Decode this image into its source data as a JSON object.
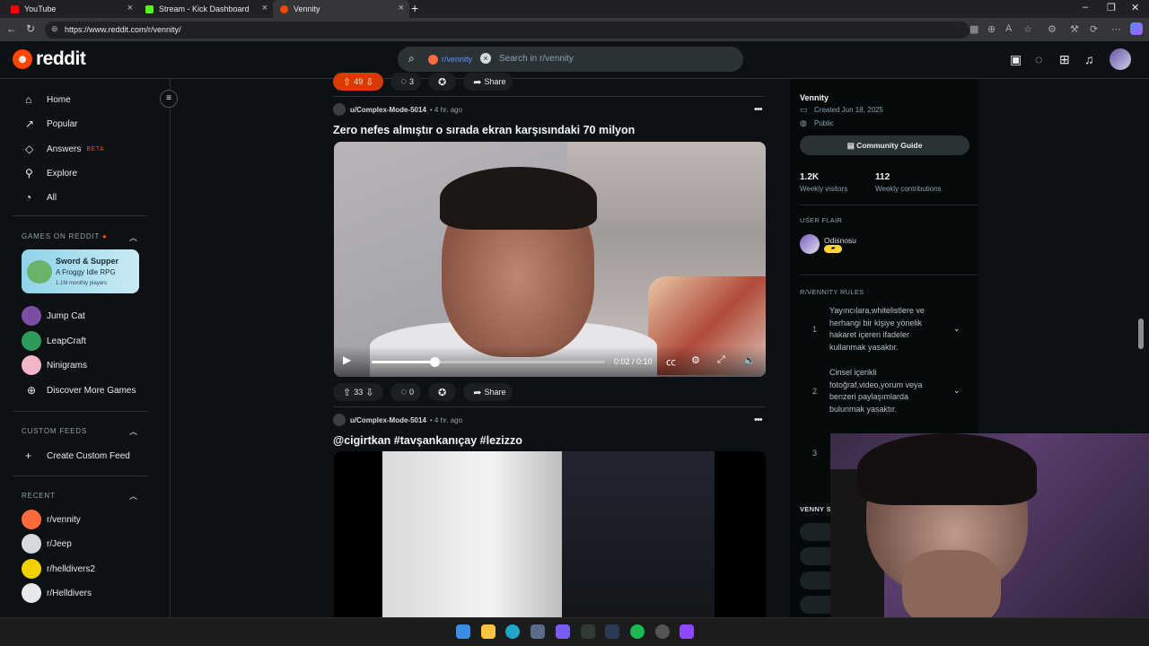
{
  "browser": {
    "tabs": [
      {
        "label": "YouTube",
        "color": "#ff0000"
      },
      {
        "label": "Stream - Kick Dashboard",
        "color": "#53fc18"
      },
      {
        "label": "Vennity",
        "color": "#ff4500"
      }
    ],
    "url": "https://www.reddit.com/r/vennity/"
  },
  "header": {
    "logo_text": "reddit",
    "search_chip": "r/vennity",
    "search_placeholder": "Search in r/vennity"
  },
  "sidebar": {
    "nav": [
      {
        "label": "Home",
        "icon": "home-icon"
      },
      {
        "label": "Popular",
        "icon": "popular-icon"
      },
      {
        "label": "Answers",
        "icon": "answers-icon",
        "badge": "BETA"
      },
      {
        "label": "Explore",
        "icon": "explore-icon"
      },
      {
        "label": "All",
        "icon": "all-icon"
      }
    ],
    "games_heading": "GAMES ON REDDIT",
    "featured_game": {
      "title": "Sword & Supper",
      "subtitle": "A Froggy Idle RPG",
      "players": "1.1M monthly players"
    },
    "games": [
      "Jump Cat",
      "LeapCraft",
      "Ninigrams",
      "Discover More Games"
    ],
    "custom_heading": "CUSTOM FEEDS",
    "create_feed": "Create Custom Feed",
    "recent_heading": "RECENT",
    "recent": [
      "r/vennity",
      "r/Jeep",
      "r/helldivers2",
      "r/Helldivers"
    ]
  },
  "feed": {
    "top_actions": {
      "votes": "49",
      "comments": "3",
      "share": "Share"
    },
    "post1": {
      "user": "u/Complex-Mode-5014",
      "time": "• 4 hr. ago",
      "title": "Zero nefes almıştır o sırada ekran karşısındaki 70 milyon",
      "video_time": "0:02 / 0:10",
      "progress": 0.27,
      "votes": "33",
      "comments": "0",
      "share": "Share"
    },
    "post2": {
      "user": "u/Complex-Mode-5014",
      "time": "• 4 hr. ago",
      "title": "@cigirtkan #tavşankanıçay #lezizzo"
    }
  },
  "right": {
    "name": "Vennity",
    "created": "Created Jun 18, 2025",
    "visibility": "Public",
    "guide_button": "Community Guide",
    "visitors_value": "1.2K",
    "visitors_label": "Weekly visitors",
    "contrib_value": "112",
    "contrib_label": "Weekly contributions",
    "flair_heading": "USER FLAIR",
    "flair_user": "Odisnosu",
    "rules_heading": "R/VENNITY RULES",
    "rules": [
      {
        "n": "1",
        "text": "Yayıncılara,whitelistlere ve herhangi bir kişiye yönelik hakaret içeren ifadeler kullanmak yasaktır."
      },
      {
        "n": "2",
        "text": "Cinsel içerikli fotoğraf,video,yorum veya benzeri paylaşımlarda bulunmak yasaktır."
      },
      {
        "n": "3",
        "text": ""
      }
    ],
    "bottom_heading": "VENNY S"
  }
}
